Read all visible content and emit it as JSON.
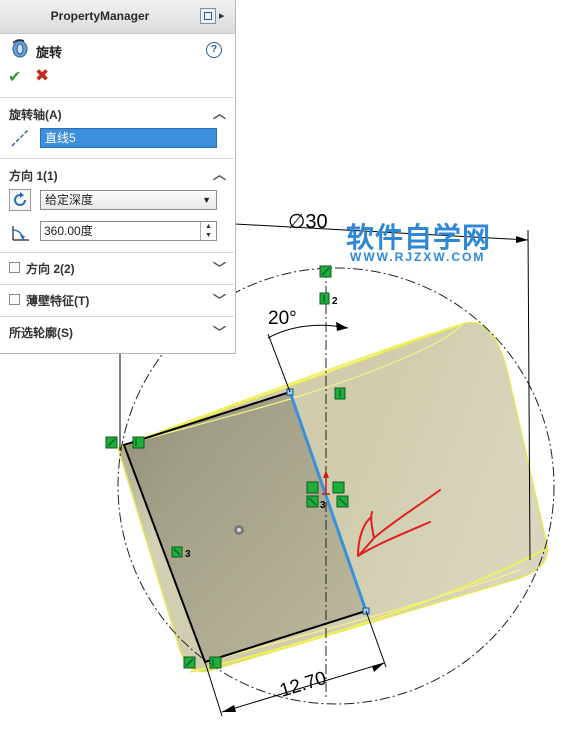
{
  "property_manager": {
    "title": "PropertyManager",
    "feature_name": "旋转",
    "help": "?",
    "ok": "✔",
    "cancel": "✖",
    "sections": {
      "axis": {
        "title": "旋转轴(A)",
        "value": "直线5"
      },
      "direction1": {
        "title": "方向 1(1)",
        "end_condition": "给定深度",
        "angle": "360.00度"
      },
      "direction2": {
        "title": "方向 2(2)"
      },
      "thin_feature": {
        "title": "薄壁特征(T)"
      },
      "selected_contours": {
        "title": "所选轮廓(S)"
      }
    }
  },
  "watermark": {
    "title": "软件自学网",
    "url": "WWW.RJZXW.COM"
  },
  "dimensions": {
    "diameter": "∅30",
    "angle": "20°",
    "length": "12.70"
  },
  "relation_labels": {
    "left_vertical": "3",
    "top_vertical": "2",
    "center": "3"
  },
  "colors": {
    "body": "#c9c6a6",
    "edge_highlight": "#f0f05a",
    "axis_line": "#3c8fdb",
    "sketch": "#000000",
    "relation_green": "#1fae3a",
    "annotation_red": "#e02020",
    "watermark_blue": "#2f88d6"
  }
}
